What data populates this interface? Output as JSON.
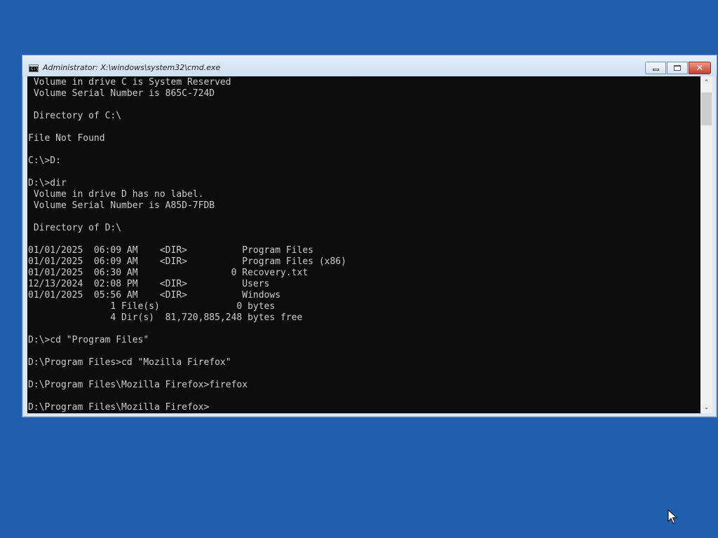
{
  "window": {
    "title": "Administrator: X:\\windows\\system32\\cmd.exe",
    "icon": "cmd-icon",
    "icon_label": "C:\\",
    "controls": {
      "minimize": "minimize-icon",
      "maximize": "maximize-icon",
      "close": "close-icon",
      "close_glyph": "✕"
    }
  },
  "console": {
    "lines": [
      " Volume in drive C is System Reserved",
      " Volume Serial Number is 865C-724D",
      "",
      " Directory of C:\\",
      "",
      "File Not Found",
      "",
      "C:\\>D:",
      "",
      "D:\\>dir",
      " Volume in drive D has no label.",
      " Volume Serial Number is A85D-7FDB",
      "",
      " Directory of D:\\",
      "",
      "01/01/2025  06:09 AM    <DIR>          Program Files",
      "01/01/2025  06:09 AM    <DIR>          Program Files (x86)",
      "01/01/2025  06:30 AM                 0 Recovery.txt",
      "12/13/2024  02:08 PM    <DIR>          Users",
      "01/01/2025  05:56 AM    <DIR>          Windows",
      "               1 File(s)              0 bytes",
      "               4 Dir(s)  81,720,885,248 bytes free",
      "",
      "D:\\>cd \"Program Files\"",
      "",
      "D:\\Program Files>cd \"Mozilla Firefox\"",
      "",
      "D:\\Program Files\\Mozilla Firefox>firefox",
      "",
      "D:\\Program Files\\Mozilla Firefox>"
    ]
  },
  "scrollbar": {
    "up_arrow": "⌃",
    "down_arrow": "⌄"
  },
  "colors": {
    "desktop": "#1f5fad",
    "console_bg": "#0c0c0c",
    "console_text": "#cccccc"
  }
}
